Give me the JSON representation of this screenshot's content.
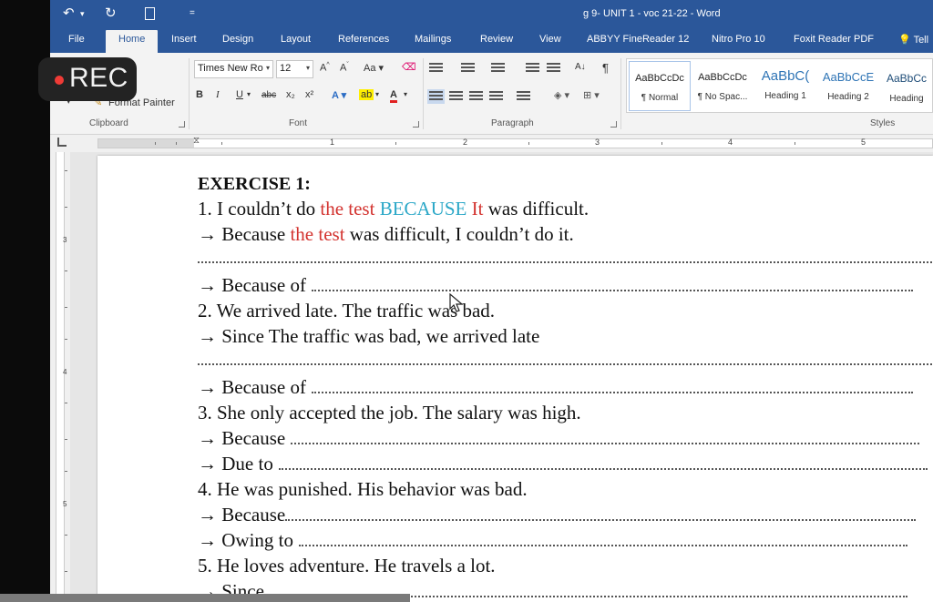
{
  "titlebar": {
    "title": "g 9- UNIT 1 - voc 21-22 - Word",
    "qa_undo": "↶",
    "qa_dropdown": "▾",
    "qa_redo": "↻",
    "qa_more": "="
  },
  "tabs": [
    "File",
    "Home",
    "Insert",
    "Design",
    "Layout",
    "References",
    "Mailings",
    "Review",
    "View",
    "ABBYY FineReader 12",
    "Nitro Pro 10",
    "Foxit Reader PDF",
    "Tell"
  ],
  "ribbon": {
    "clipboard": {
      "format_painter": "Format Painter",
      "label": "Clipboard"
    },
    "font": {
      "name": "Times New Ro",
      "size": "12",
      "grow": "A",
      "shrink": "A",
      "case": "Aa",
      "bold": "B",
      "italic": "I",
      "underline": "U",
      "strike": "abc",
      "subscript": "x₂",
      "superscript": "x²",
      "effects": "A",
      "highlight": "ab",
      "color": "A",
      "label": "Font"
    },
    "paragraph": {
      "pilcrow": "¶",
      "sort": "A↓",
      "label": "Paragraph"
    },
    "styles": {
      "label": "Styles",
      "items": [
        {
          "sample": "AaBbCcDc",
          "name": "¶ Normal"
        },
        {
          "sample": "AaBbCcDc",
          "name": "¶ No Spac..."
        },
        {
          "sample": "AaBbC(",
          "name": "Heading 1"
        },
        {
          "sample": "AaBbCcE",
          "name": "Heading 2"
        },
        {
          "sample": "AaBbCc",
          "name": "Heading"
        }
      ]
    }
  },
  "ruler": {
    "numbers": [
      "1",
      "2",
      "3",
      "4",
      "5"
    ],
    "vnumbers": [
      "3",
      "4",
      "5"
    ]
  },
  "rec": {
    "label": "REC"
  },
  "document": {
    "heading": "EXERCISE 1:",
    "l1_a": "1. I couldn’t do ",
    "l1_red": "the test",
    "l1_b": " ",
    "l1_blue": "BECAUSE",
    "l1_c": " ",
    "l1_red2": "It",
    "l1_d": " was difficult.",
    "l2_a": "→ Because ",
    "l2_red": "the test",
    "l2_b": " was difficult, I couldn’t do it.",
    "l3": "→ Because of",
    "l4": "2. We arrived late. The traffic was bad.",
    "l5": "→ Since The traffic was bad, we arrived late",
    "l6": "→ Because of",
    "l7": "3. She only accepted the job. The salary was high.",
    "l8": "→ Because",
    "l9": "→ Due to",
    "l10": "4. He was punished. His behavior was bad.",
    "l11": "→ Because",
    "l12": "→ Owing to",
    "l13": "5. He loves adventure. He travels a lot.",
    "l14": "→ Since"
  },
  "colors": {
    "word_blue": "#2b579a",
    "red_text": "#d3332f",
    "blue_text": "#2aa7c7",
    "rec_dot": "#ef3b36"
  }
}
